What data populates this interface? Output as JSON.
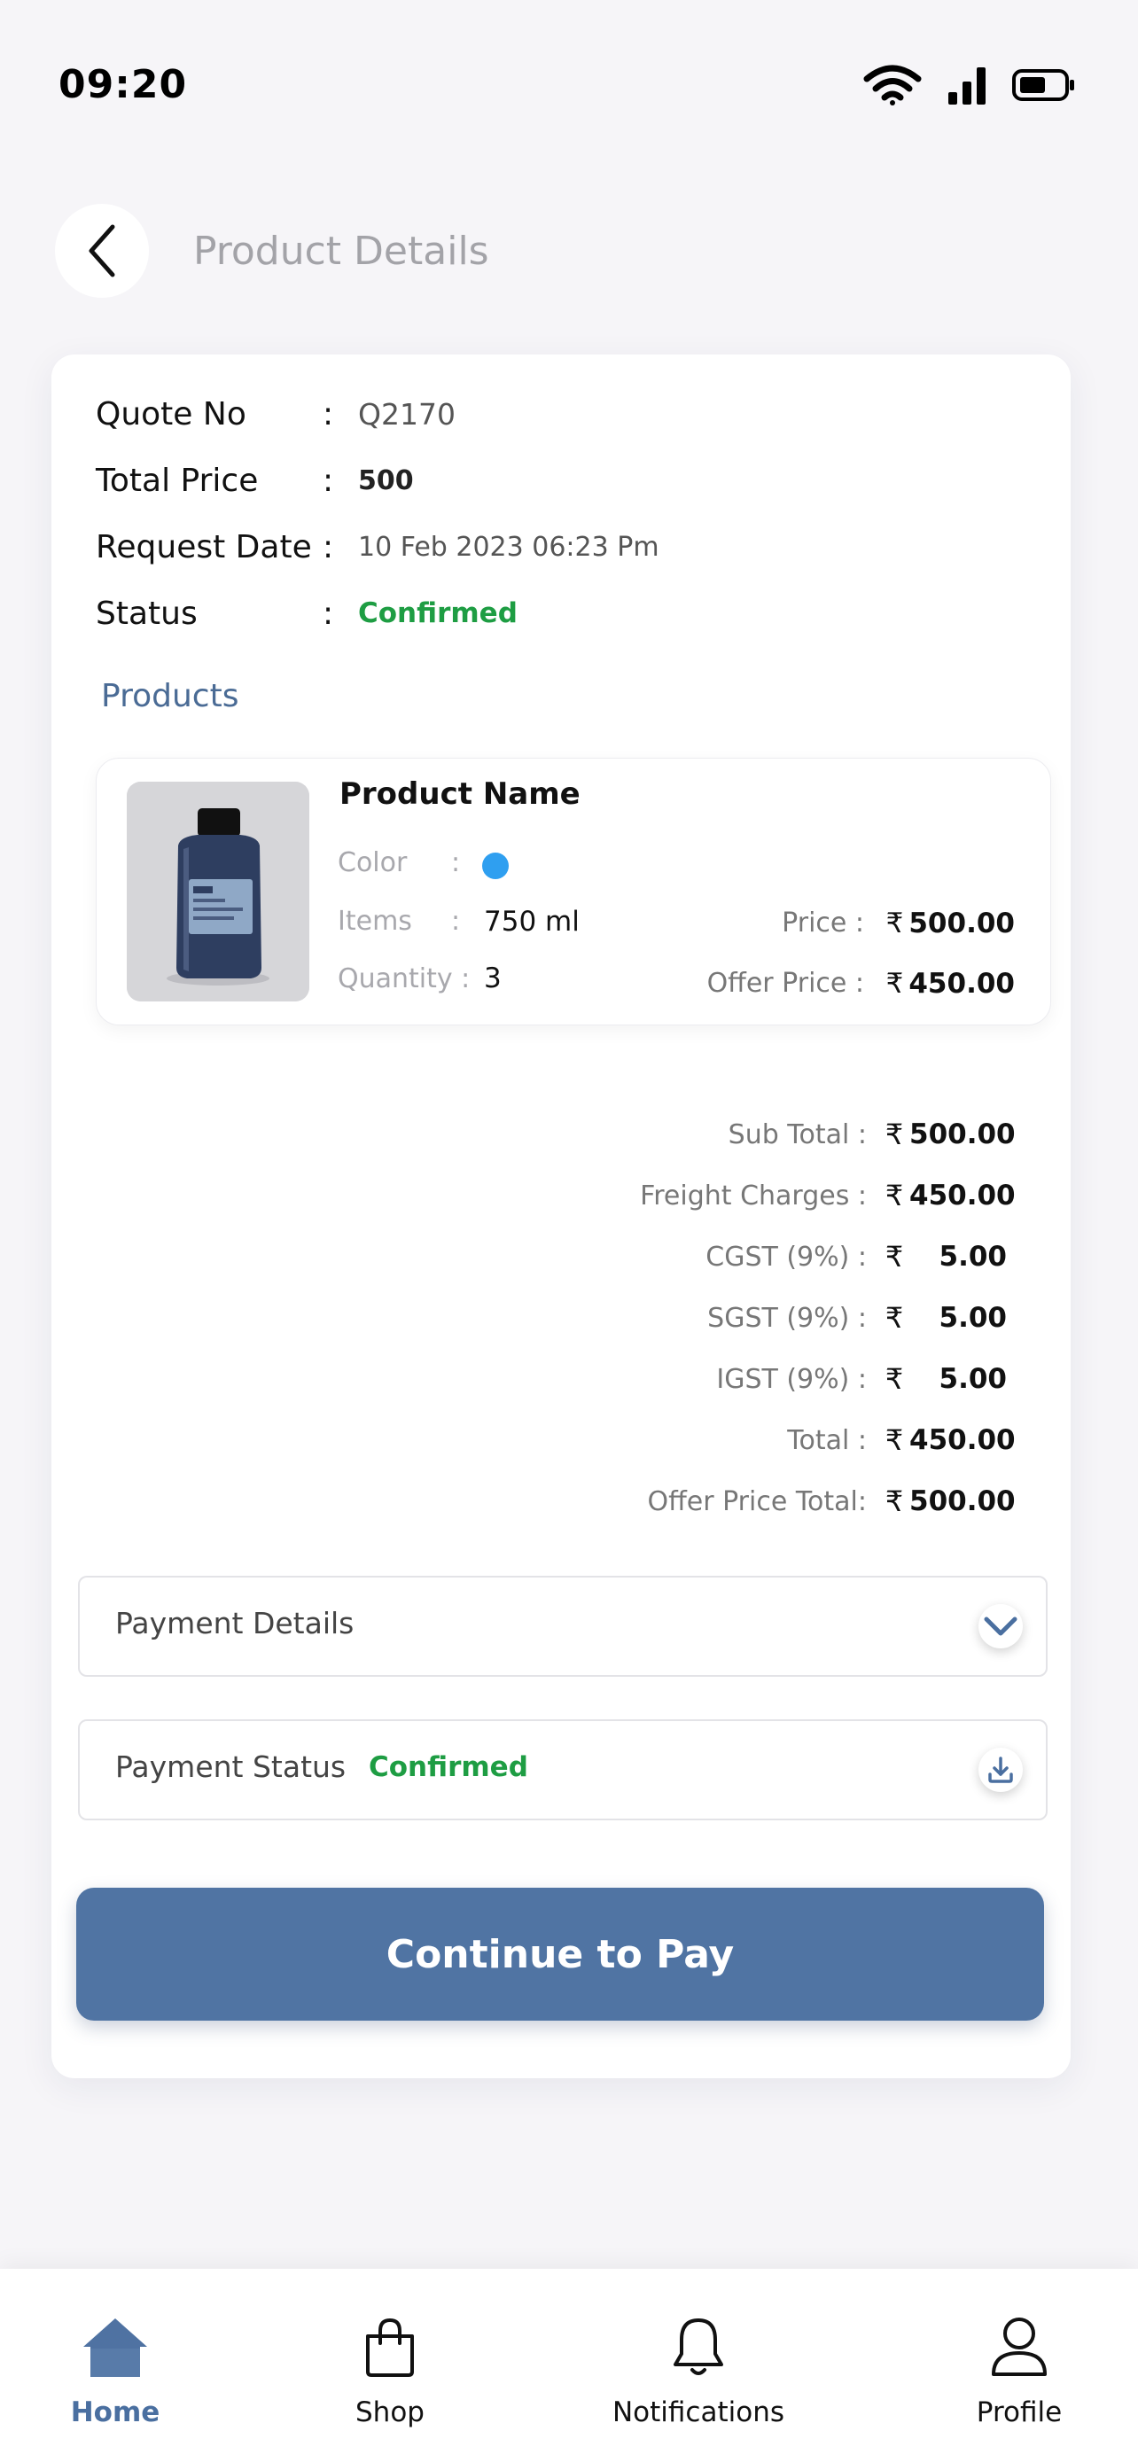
{
  "status_bar": {
    "time": "09:20"
  },
  "header": {
    "title": "Product Details"
  },
  "quote": {
    "rows": [
      {
        "label": "Quote No",
        "colon": ":",
        "value": "Q2170"
      },
      {
        "label": "Total Price",
        "colon": ":",
        "value": "500"
      },
      {
        "label": "Request Date",
        "colon": ":",
        "value": "10 Feb 2023 06:23 Pm"
      },
      {
        "label": "Status",
        "colon": ":",
        "value": "Confirmed"
      }
    ]
  },
  "products": {
    "title": "Products",
    "item": {
      "name": "Product Name",
      "color_label": "Color",
      "color_value": "#2f9ff0",
      "items_label": "Items",
      "items_value": "750 ml",
      "quantity_label": "Quantity :",
      "quantity_value": "3",
      "colon": ":",
      "price_label": "Price :",
      "price_value": "500.00",
      "offer_price_label": "Offer Price :",
      "offer_price_value": "450.00",
      "currency": "₹"
    }
  },
  "summary": {
    "currency": "₹",
    "rows": [
      {
        "label": "Sub Total :",
        "value": "500.00"
      },
      {
        "label": "Freight Charges :",
        "value": "450.00"
      },
      {
        "label": "CGST (9%) :",
        "value": "5.00"
      },
      {
        "label": "SGST (9%) :",
        "value": "5.00"
      },
      {
        "label": "IGST (9%) :",
        "value": "5.00"
      },
      {
        "label": "Total :",
        "value": "450.00"
      },
      {
        "label": "Offer Price Total:",
        "value": "500.00"
      }
    ]
  },
  "payment_details": {
    "label": "Payment Details"
  },
  "payment_status": {
    "label": "Payment Status",
    "value": "Confirmed"
  },
  "cta": {
    "label": "Continue to Pay"
  },
  "nav": {
    "items": [
      {
        "label": "Home",
        "icon": "home-icon",
        "active": true
      },
      {
        "label": "Shop",
        "icon": "shopping-bag-icon",
        "active": false
      },
      {
        "label": "Notifications",
        "icon": "bell-icon",
        "active": false
      },
      {
        "label": "Profile",
        "icon": "user-icon",
        "active": false
      }
    ]
  },
  "colors": {
    "accent": "#5074a3",
    "success": "#1e9d43",
    "dot": "#2f9ff0"
  }
}
